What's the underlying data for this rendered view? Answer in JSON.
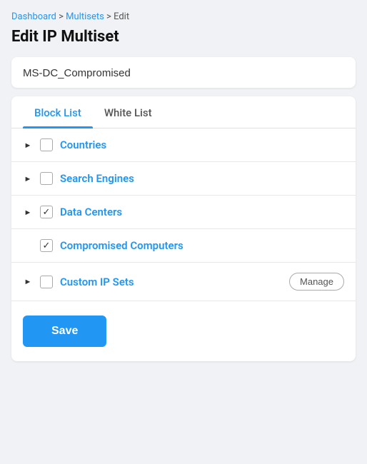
{
  "breadcrumb": {
    "dashboard": "Dashboard",
    "separator1": " > ",
    "multisets": "Multisets",
    "separator2": " > ",
    "current": "Edit"
  },
  "page_title": "Edit IP Multiset",
  "name_input": {
    "value": "MS-DC_Compromised",
    "placeholder": "Multiset name"
  },
  "tabs": [
    {
      "id": "block-list",
      "label": "Block List",
      "active": true
    },
    {
      "id": "white-list",
      "label": "White List",
      "active": false
    }
  ],
  "list_items": [
    {
      "id": "countries",
      "label": "Countries",
      "has_chevron": true,
      "checked": false,
      "indented": false,
      "has_manage": false
    },
    {
      "id": "search-engines",
      "label": "Search Engines",
      "has_chevron": true,
      "checked": false,
      "indented": false,
      "has_manage": false
    },
    {
      "id": "data-centers",
      "label": "Data Centers",
      "has_chevron": true,
      "checked": true,
      "indented": false,
      "has_manage": false
    },
    {
      "id": "compromised-computers",
      "label": "Compromised Computers",
      "has_chevron": false,
      "checked": true,
      "indented": true,
      "has_manage": false
    },
    {
      "id": "custom-ip-sets",
      "label": "Custom IP Sets",
      "has_chevron": true,
      "checked": false,
      "indented": false,
      "has_manage": true,
      "manage_label": "Manage"
    }
  ],
  "save_button": "Save",
  "colors": {
    "blue": "#2196f3",
    "accent": "#2196f3"
  }
}
